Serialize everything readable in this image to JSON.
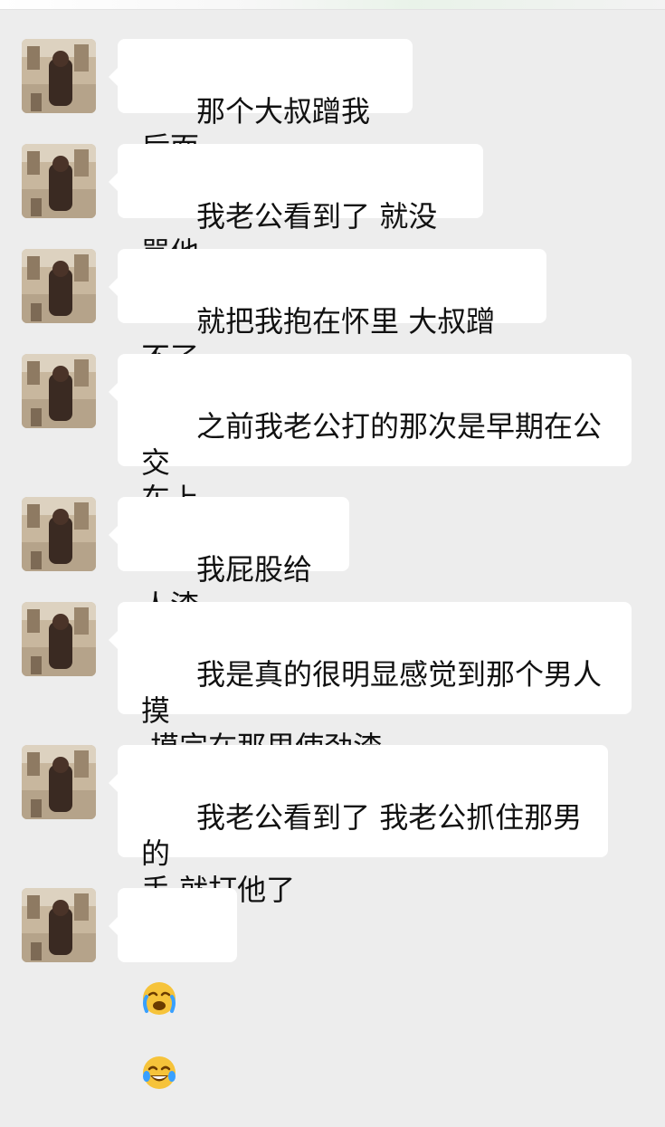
{
  "messages": [
    {
      "text": "那个大叔蹭我后面"
    },
    {
      "text": "我老公看到了 就没骂他"
    },
    {
      "text": "就把我抱在怀里 大叔蹭不了"
    },
    {
      "text": "之前我老公打的那次是早期在公交\n车上"
    },
    {
      "text": "我屁股给人渣"
    },
    {
      "text": "我是真的很明显感觉到那个男人摸\n 摸完在那里使劲渣"
    },
    {
      "text": "我老公看到了 我老公抓住那男的\n手 就打他了"
    },
    {
      "emoji": [
        "loudly-crying-face",
        "face-with-tears-of-joy"
      ]
    }
  ],
  "colors": {
    "background": "#ededed",
    "bubble": "#ffffff",
    "text": "#111111",
    "emoji_yellow": "#f6c33a"
  }
}
